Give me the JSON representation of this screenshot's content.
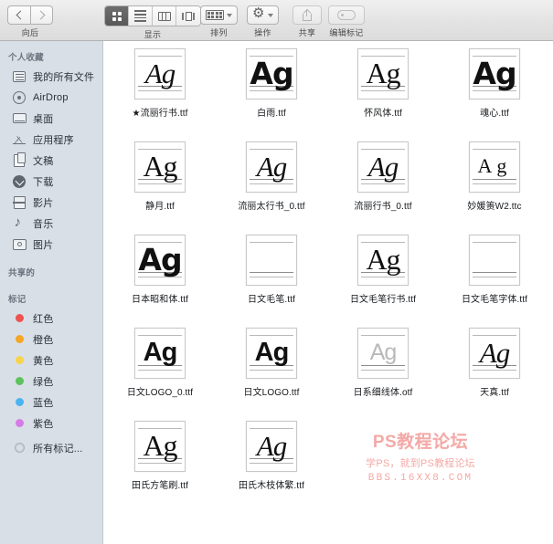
{
  "toolbar": {
    "nav": {
      "back_label": "向后",
      "back_icon": "chevron-left-icon",
      "forward_icon": "chevron-right-icon"
    },
    "view": {
      "label": "显示",
      "modes": [
        {
          "name": "icon-view",
          "icon": "grid-icon",
          "active": true
        },
        {
          "name": "list-view",
          "icon": "list-icon",
          "active": false
        },
        {
          "name": "column-view",
          "icon": "columns-icon",
          "active": false
        },
        {
          "name": "gallery-view",
          "icon": "coverflow-icon",
          "active": false
        }
      ]
    },
    "arrange": {
      "label": "排列",
      "icon": "arrange-grid-icon"
    },
    "action": {
      "label": "操作",
      "icon": "gear-icon"
    },
    "share": {
      "label": "共享",
      "icon": "share-icon"
    },
    "tags": {
      "label": "编辑标记",
      "icon": "tag-icon"
    }
  },
  "sidebar": {
    "sections": [
      {
        "title": "个人收藏",
        "items": [
          {
            "label": "我的所有文件",
            "icon": "all-files-icon"
          },
          {
            "label": "AirDrop",
            "icon": "airdrop-icon"
          },
          {
            "label": "桌面",
            "icon": "desktop-icon"
          },
          {
            "label": "应用程序",
            "icon": "applications-icon"
          },
          {
            "label": "文稿",
            "icon": "documents-icon"
          },
          {
            "label": "下载",
            "icon": "downloads-icon"
          },
          {
            "label": "影片",
            "icon": "movies-icon"
          },
          {
            "label": "音乐",
            "icon": "music-icon"
          },
          {
            "label": "图片",
            "icon": "pictures-icon"
          }
        ]
      },
      {
        "title": "共享的",
        "items": []
      },
      {
        "title": "标记",
        "items": [
          {
            "label": "红色",
            "icon": "tag-dot-icon",
            "color": "#ef5350"
          },
          {
            "label": "橙色",
            "icon": "tag-dot-icon",
            "color": "#f5a623"
          },
          {
            "label": "黄色",
            "icon": "tag-dot-icon",
            "color": "#f7d44c"
          },
          {
            "label": "绿色",
            "icon": "tag-dot-icon",
            "color": "#5cc25c"
          },
          {
            "label": "蓝色",
            "icon": "tag-dot-icon",
            "color": "#4bb4f0"
          },
          {
            "label": "紫色",
            "icon": "tag-dot-icon",
            "color": "#d67ce8"
          },
          {
            "label": "所有标记...",
            "icon": "all-tags-icon",
            "color": ""
          }
        ]
      }
    ]
  },
  "files": [
    {
      "name": "★流丽行书.ttf",
      "preview": "Ag",
      "style": "italic"
    },
    {
      "name": "白雨.ttf",
      "preview": "Ag",
      "style": "heavy"
    },
    {
      "name": "怀风体.ttf",
      "preview": "Ag",
      "style": "serif"
    },
    {
      "name": "魂心.ttf",
      "preview": "Ag",
      "style": "heavy"
    },
    {
      "name": "静月.ttf",
      "preview": "Ag",
      "style": "serif"
    },
    {
      "name": "流丽太行书_0.ttf",
      "preview": "Ag",
      "style": "italic"
    },
    {
      "name": "流丽行书_0.ttf",
      "preview": "Ag",
      "style": "italic"
    },
    {
      "name": "妙媛箦W2.ttc",
      "preview": "Ag",
      "style": "wide"
    },
    {
      "name": "日本昭和体.ttf",
      "preview": "Ag",
      "style": "heavy"
    },
    {
      "name": "日文毛笔.ttf",
      "preview": "",
      "style": "empty"
    },
    {
      "name": "日文毛笔行书.ttf",
      "preview": "Ag",
      "style": "serif"
    },
    {
      "name": "日文毛笔字体.ttf",
      "preview": "",
      "style": "empty"
    },
    {
      "name": "日文LOGO_0.ttf",
      "preview": "Ag",
      "style": "bold"
    },
    {
      "name": "日文LOGO.ttf",
      "preview": "Ag",
      "style": "bold"
    },
    {
      "name": "日系细线体.otf",
      "preview": "Ag",
      "style": "ghost"
    },
    {
      "name": "天真.ttf",
      "preview": "Ag",
      "style": "italic"
    },
    {
      "name": "田氏方笔刷.ttf",
      "preview": "Ag",
      "style": "serif"
    },
    {
      "name": "田氏木枝体繁.ttf",
      "preview": "Ag",
      "style": "italic"
    }
  ],
  "watermark": {
    "line1": "PS教程论坛",
    "line2": "学PS，就到PS教程论坛",
    "line3": "BBS.16XX8.COM",
    "color": "#f4a9a6"
  }
}
